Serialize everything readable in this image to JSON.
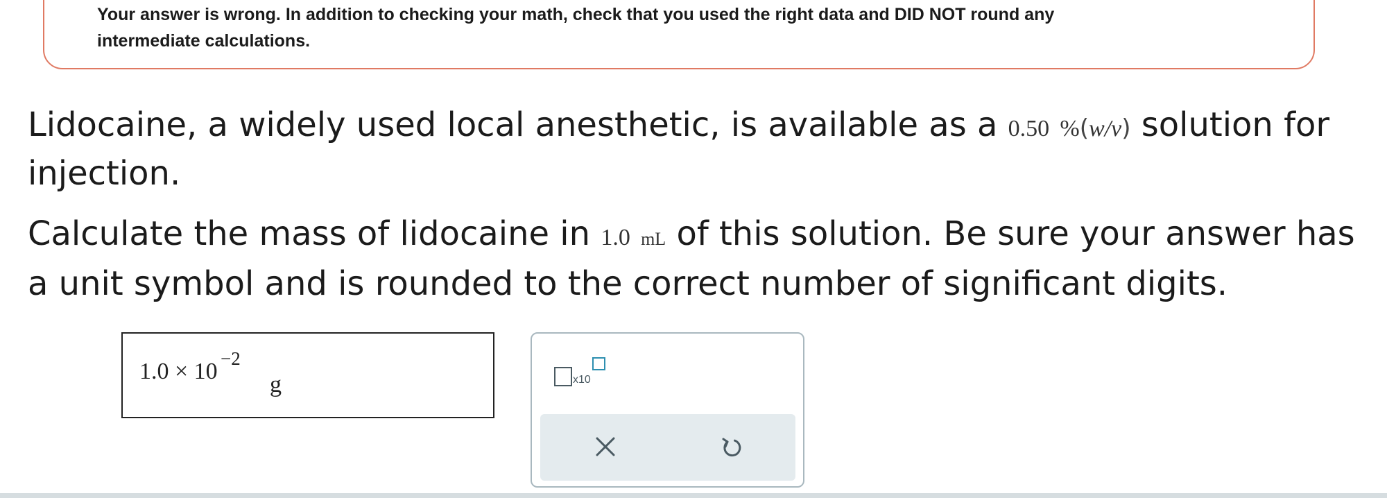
{
  "feedback": {
    "line1": "Your answer is wrong. In addition to checking your math, check that you used the right data and DID NOT round any",
    "line2": "intermediate calculations."
  },
  "question": {
    "p1_before": "Lidocaine, a widely used local anesthetic, is available as a ",
    "p1_value": "0.50",
    "p1_percent": "%",
    "p1_wv": "w/v",
    "p1_after": " solution for injection.",
    "p2_before": "Calculate the mass of lidocaine in ",
    "p2_value": "1.0",
    "p2_unit": "mL",
    "p2_after": " of this solution. Be sure your answer has a unit symbol and is rounded to the correct number of significant digits."
  },
  "answer": {
    "mantissa": "1.0 × 10",
    "exponent": "−2",
    "unit": "g"
  },
  "toolbar": {
    "x10_label": "x10"
  },
  "icons": {
    "clear": "close-icon",
    "undo": "undo-icon"
  },
  "colors": {
    "feedback_border": "#e07a63",
    "tool_accent": "#2e8fb0",
    "action_bar": "#e4ebee"
  }
}
